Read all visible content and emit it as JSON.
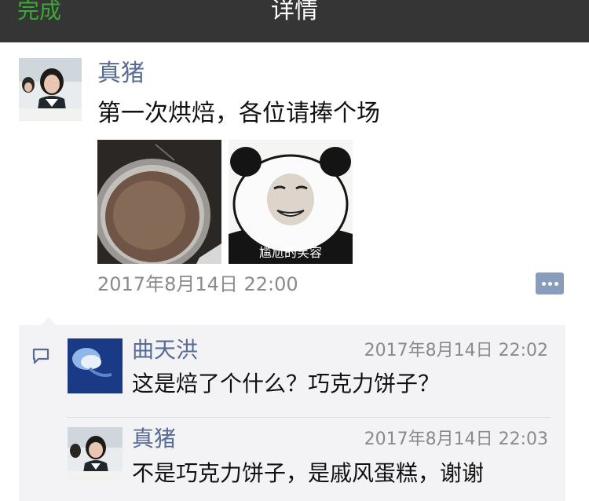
{
  "nav": {
    "back_label": "完成",
    "title": "详情"
  },
  "post": {
    "author": "真猪",
    "text": "第一次烘焙，各位请捧个场",
    "images": [
      {
        "alt": "photo-of-baked-item"
      },
      {
        "caption": "尴尬的笑容"
      }
    ],
    "time": "2017年8月14日 22:00",
    "action_icon": "comment-ellipsis-icon"
  },
  "comments": [
    {
      "author": "曲天洪",
      "time": "2017年8月14日 22:02",
      "text": "这是焙了个什么？巧克力饼子？"
    },
    {
      "author": "真猪",
      "time": "2017年8月14日 22:03",
      "text": "不是巧克力饼子，是戚风蛋糕，谢谢"
    }
  ],
  "colors": {
    "nav_bg": "#353535",
    "done_green": "#3aaa35",
    "link_blue": "#576b95",
    "comment_bg": "#f3f3f5"
  }
}
